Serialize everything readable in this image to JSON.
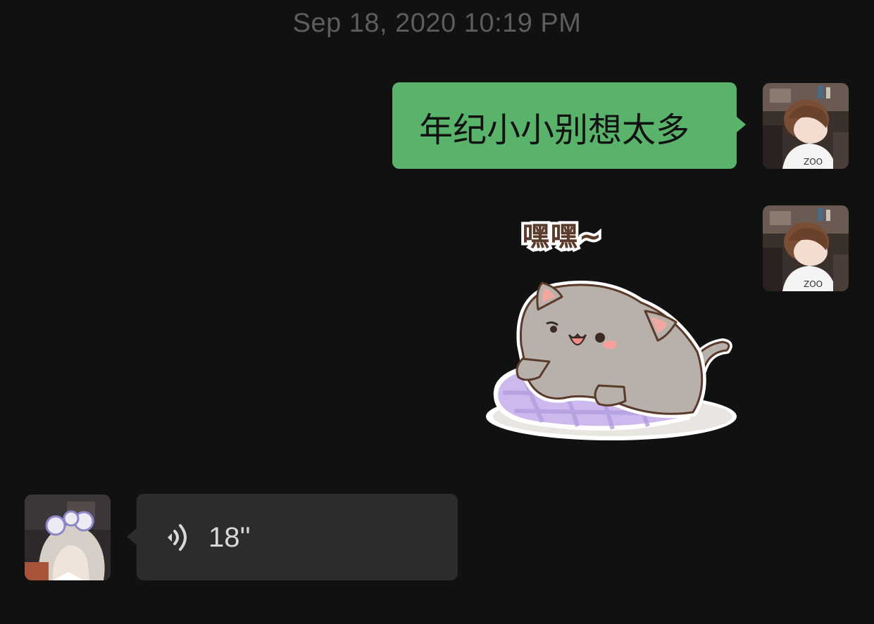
{
  "chat": {
    "timestamp": "Sep 18, 2020 10:19 PM",
    "messages": [
      {
        "sender": "me",
        "type": "text",
        "text": "年纪小小别想太多",
        "bubble_color": "#59b36a"
      },
      {
        "sender": "me",
        "type": "sticker",
        "sticker_caption": "嘿嘿~",
        "icon": "cat-on-pillow-sticker"
      },
      {
        "sender": "other",
        "type": "voice",
        "duration": "18''",
        "icon": "voice-wave-icon",
        "bubble_color": "#2c2c2c"
      }
    ]
  },
  "colors": {
    "background": "#111111",
    "timestamp_text": "#5d5d5d",
    "my_bubble": "#59b36a",
    "other_bubble": "#2c2c2c"
  }
}
